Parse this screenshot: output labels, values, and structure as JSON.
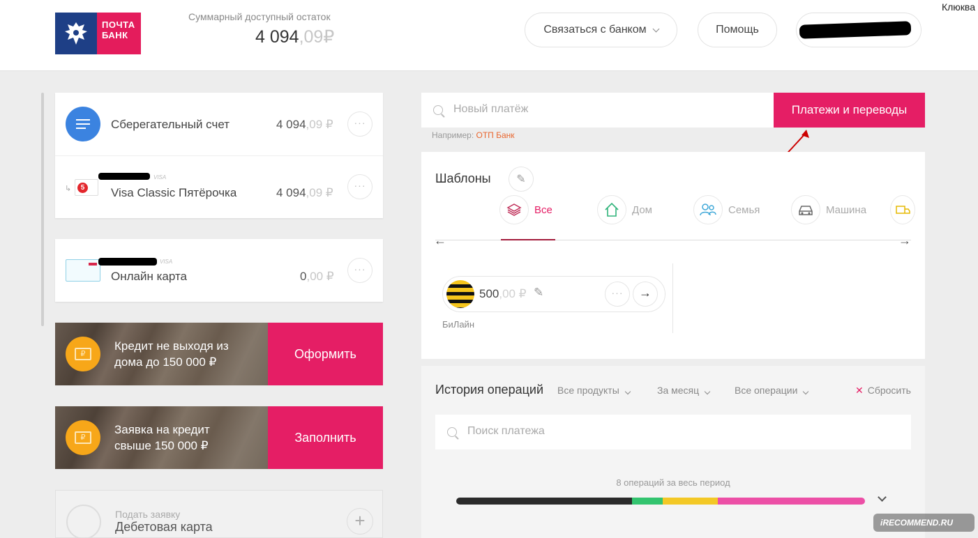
{
  "header": {
    "brand": "ПОЧТА БАНК",
    "balance_label": "Суммарный доступный остаток",
    "balance_int": "4 094",
    "balance_frac": ",09",
    "currency": "₽",
    "contact_label": "Связаться с банком",
    "help_label": "Помощь",
    "user_name": "Клюква"
  },
  "accounts": [
    {
      "name": "Сберегательный счет",
      "amount_int": "4 094",
      "amount_frac": ",09 ₽"
    },
    {
      "name": "Visa Classic Пятёрочка",
      "amount_int": "4 094",
      "amount_frac": ",09 ₽",
      "brand_tag": "VISA"
    },
    {
      "name": "Онлайн карта",
      "amount_int": "0",
      "amount_frac": ",00 ₽",
      "brand_tag": "VISA"
    }
  ],
  "promos": [
    {
      "text_line1": "Кредит не выходя из",
      "text_line2": "дома до 150 000 ₽",
      "cta": "Оформить"
    },
    {
      "text_line1": "Заявка на кредит",
      "text_line2": "свыше 150 000 ₽",
      "cta": "Заполнить"
    }
  ],
  "debit": {
    "small": "Подать заявку",
    "title": "Дебетовая карта"
  },
  "payment": {
    "search_placeholder": "Новый платёж",
    "button_label": "Платежи и переводы",
    "example_prefix": "Например:",
    "example_link": "ОТП Банк"
  },
  "templates": {
    "title": "Шаблоны",
    "categories": [
      "Все",
      "Дом",
      "Семья",
      "Машина"
    ],
    "item_amount_int": "500",
    "item_amount_frac": ",00 ₽",
    "item_name": "БиЛайн"
  },
  "history": {
    "title": "История операций",
    "filters": [
      "Все продукты",
      "За месяц",
      "Все операции"
    ],
    "reset_label": "Сбросить",
    "search_placeholder": "Поиск платежа",
    "ops_count": "8 операций за весь период",
    "bar_segments": [
      {
        "color": "#2b2b2b",
        "share": 0.43
      },
      {
        "color": "#33c46f",
        "share": 0.075
      },
      {
        "color": "#f3c826",
        "share": 0.135
      },
      {
        "color": "#ec4fa6",
        "share": 0.36
      }
    ]
  },
  "annotation": "1",
  "watermark": "iRECOMMEND.RU",
  "colors": {
    "brand_pink": "#e51e65",
    "brand_blue": "#1e3f86",
    "accent_orange": "#f7a719"
  }
}
